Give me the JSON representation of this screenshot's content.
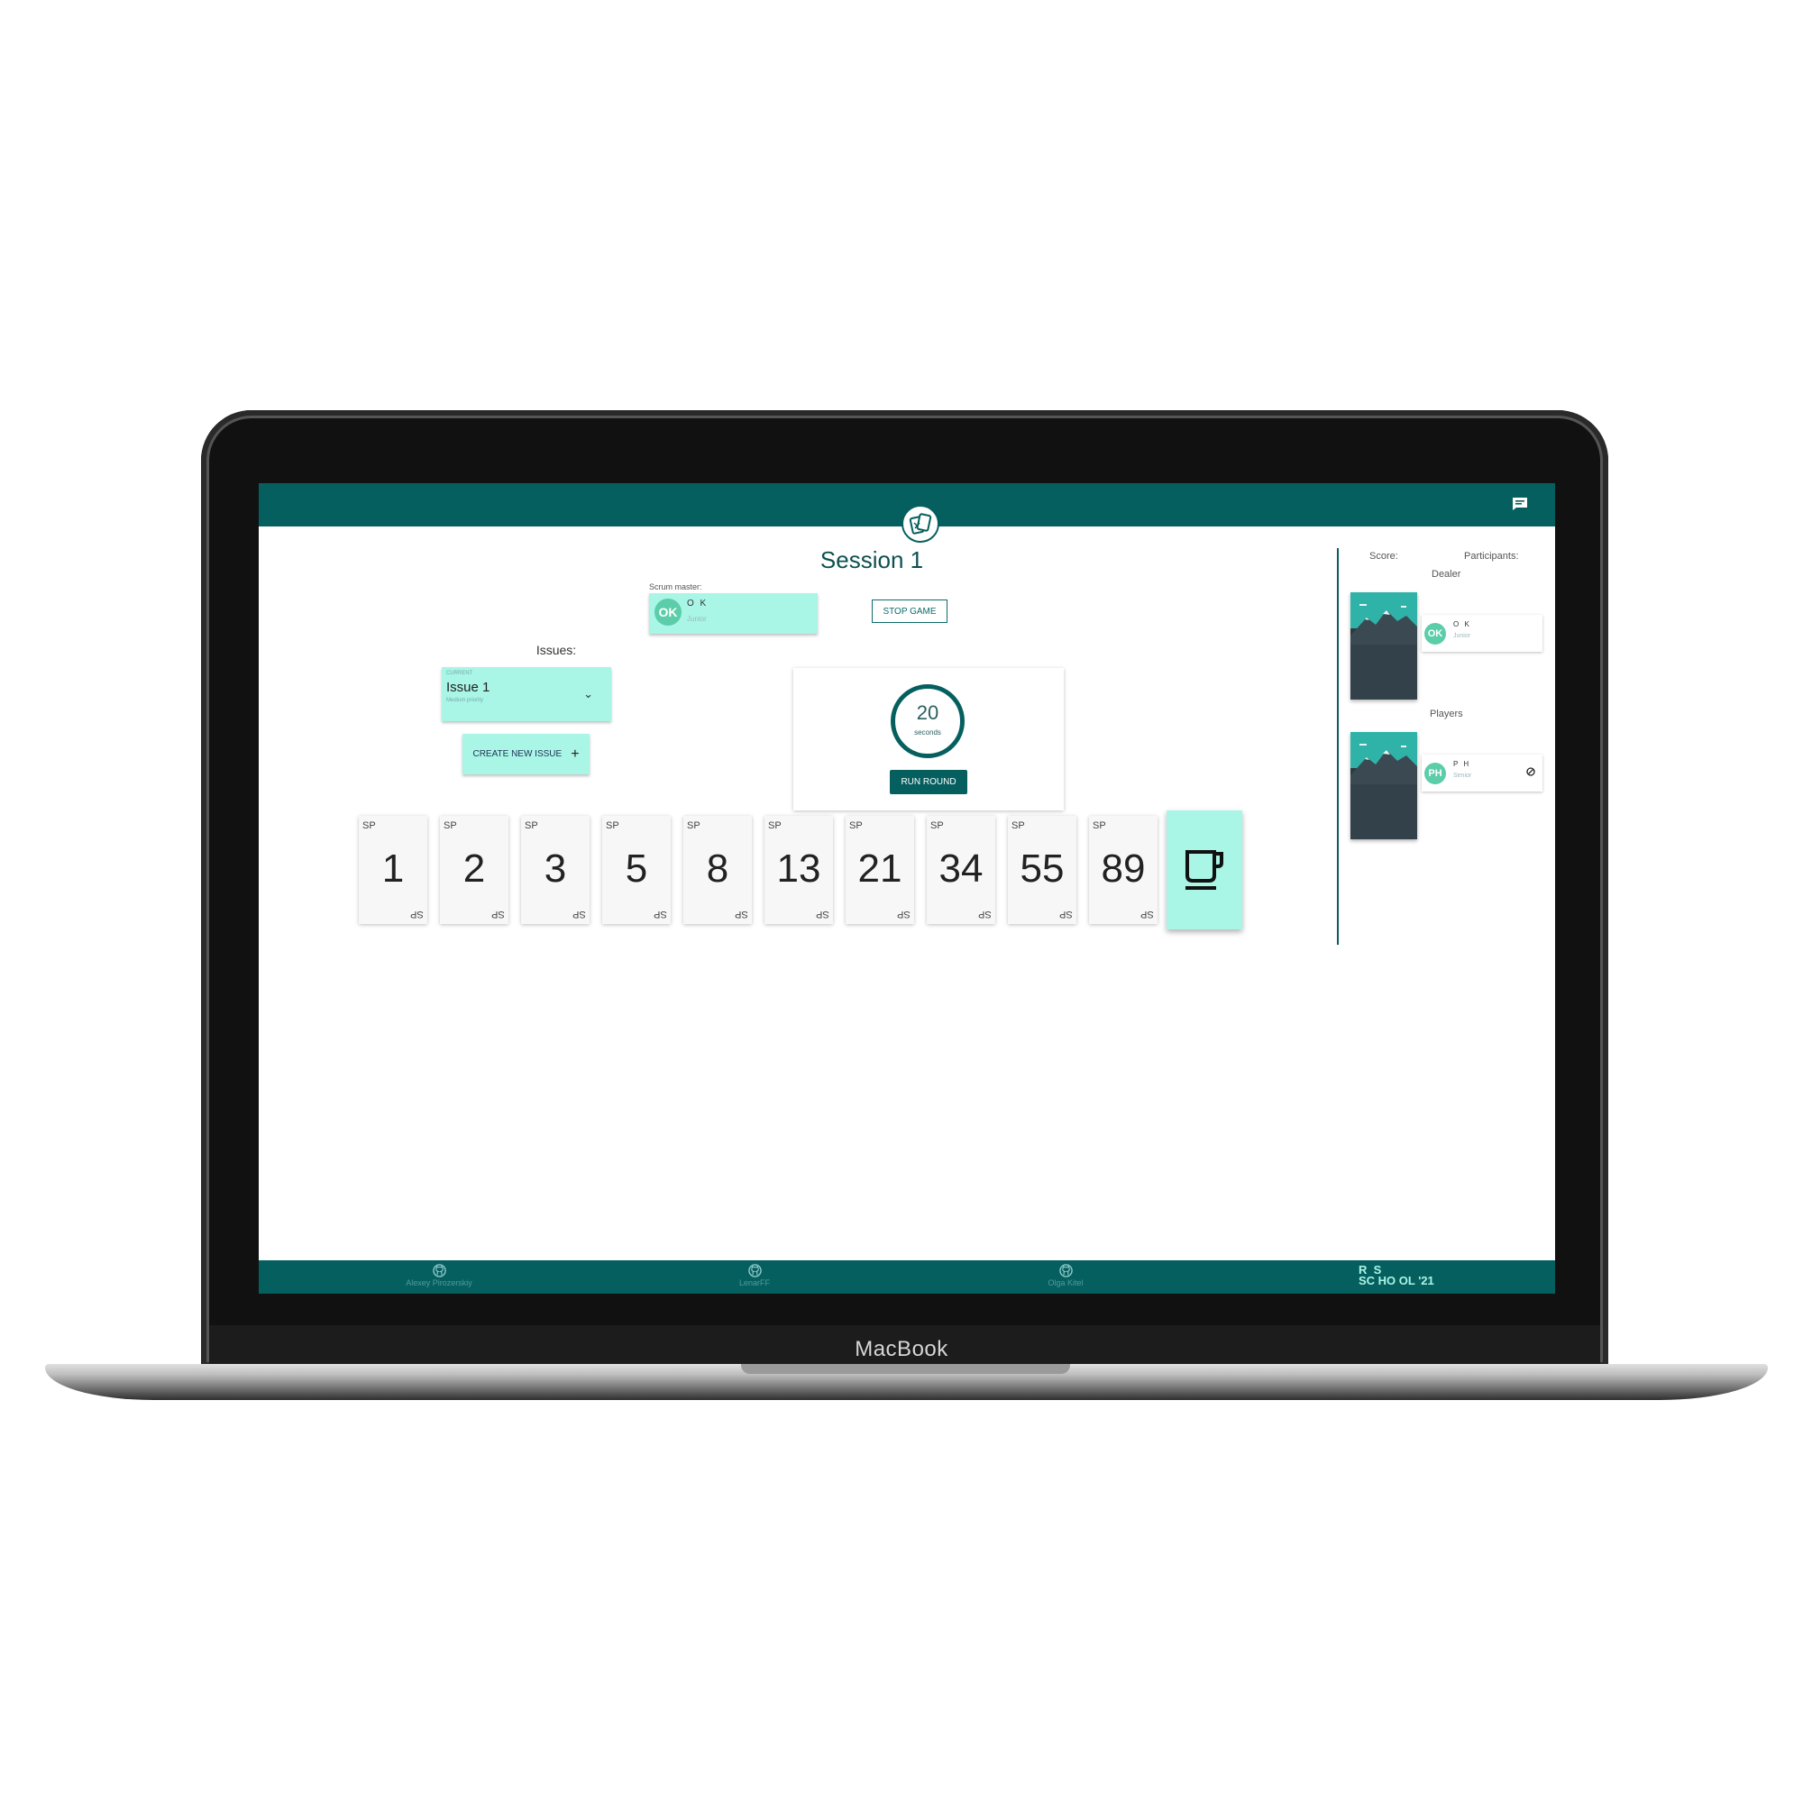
{
  "device": {
    "brand": "MacBook"
  },
  "app": {
    "session_title": "Session 1",
    "scrum_master": {
      "label": "Scrum master:",
      "initials": "OK",
      "name": "O K",
      "role": "Junior"
    },
    "stop_button": "STOP GAME",
    "issues": {
      "label": "Issues:",
      "select_caption": "CURRENT",
      "current_title": "Issue 1",
      "current_priority": "Medium priority",
      "create_button": "CREATE NEW ISSUE"
    },
    "timer": {
      "value": "20",
      "unit": "seconds",
      "run_button": "RUN ROUND"
    },
    "cards": {
      "corner_top": "SP",
      "corner_bottom": "SP",
      "values": [
        "1",
        "2",
        "3",
        "5",
        "8",
        "13",
        "21",
        "34",
        "55",
        "89"
      ],
      "coffee_icon": "coffee-cup-icon"
    },
    "sidebar": {
      "score_label": "Score:",
      "participants_label": "Participants:",
      "dealer_label": "Dealer",
      "players_label": "Players",
      "dealer": {
        "initials": "OK",
        "name": "O K",
        "role": "Junior"
      },
      "player": {
        "initials": "PH",
        "name": "P H",
        "role": "Senior"
      }
    },
    "footer": {
      "authors": [
        "Alexey Pirozerskiy",
        "LenarFF",
        "Olga Kitel"
      ],
      "school_logo": [
        "R  S",
        "SC HO OL '21"
      ]
    },
    "colors": {
      "primary": "#065f5f",
      "accent": "#a9f5e6",
      "avatar": "#5ccda9"
    }
  }
}
